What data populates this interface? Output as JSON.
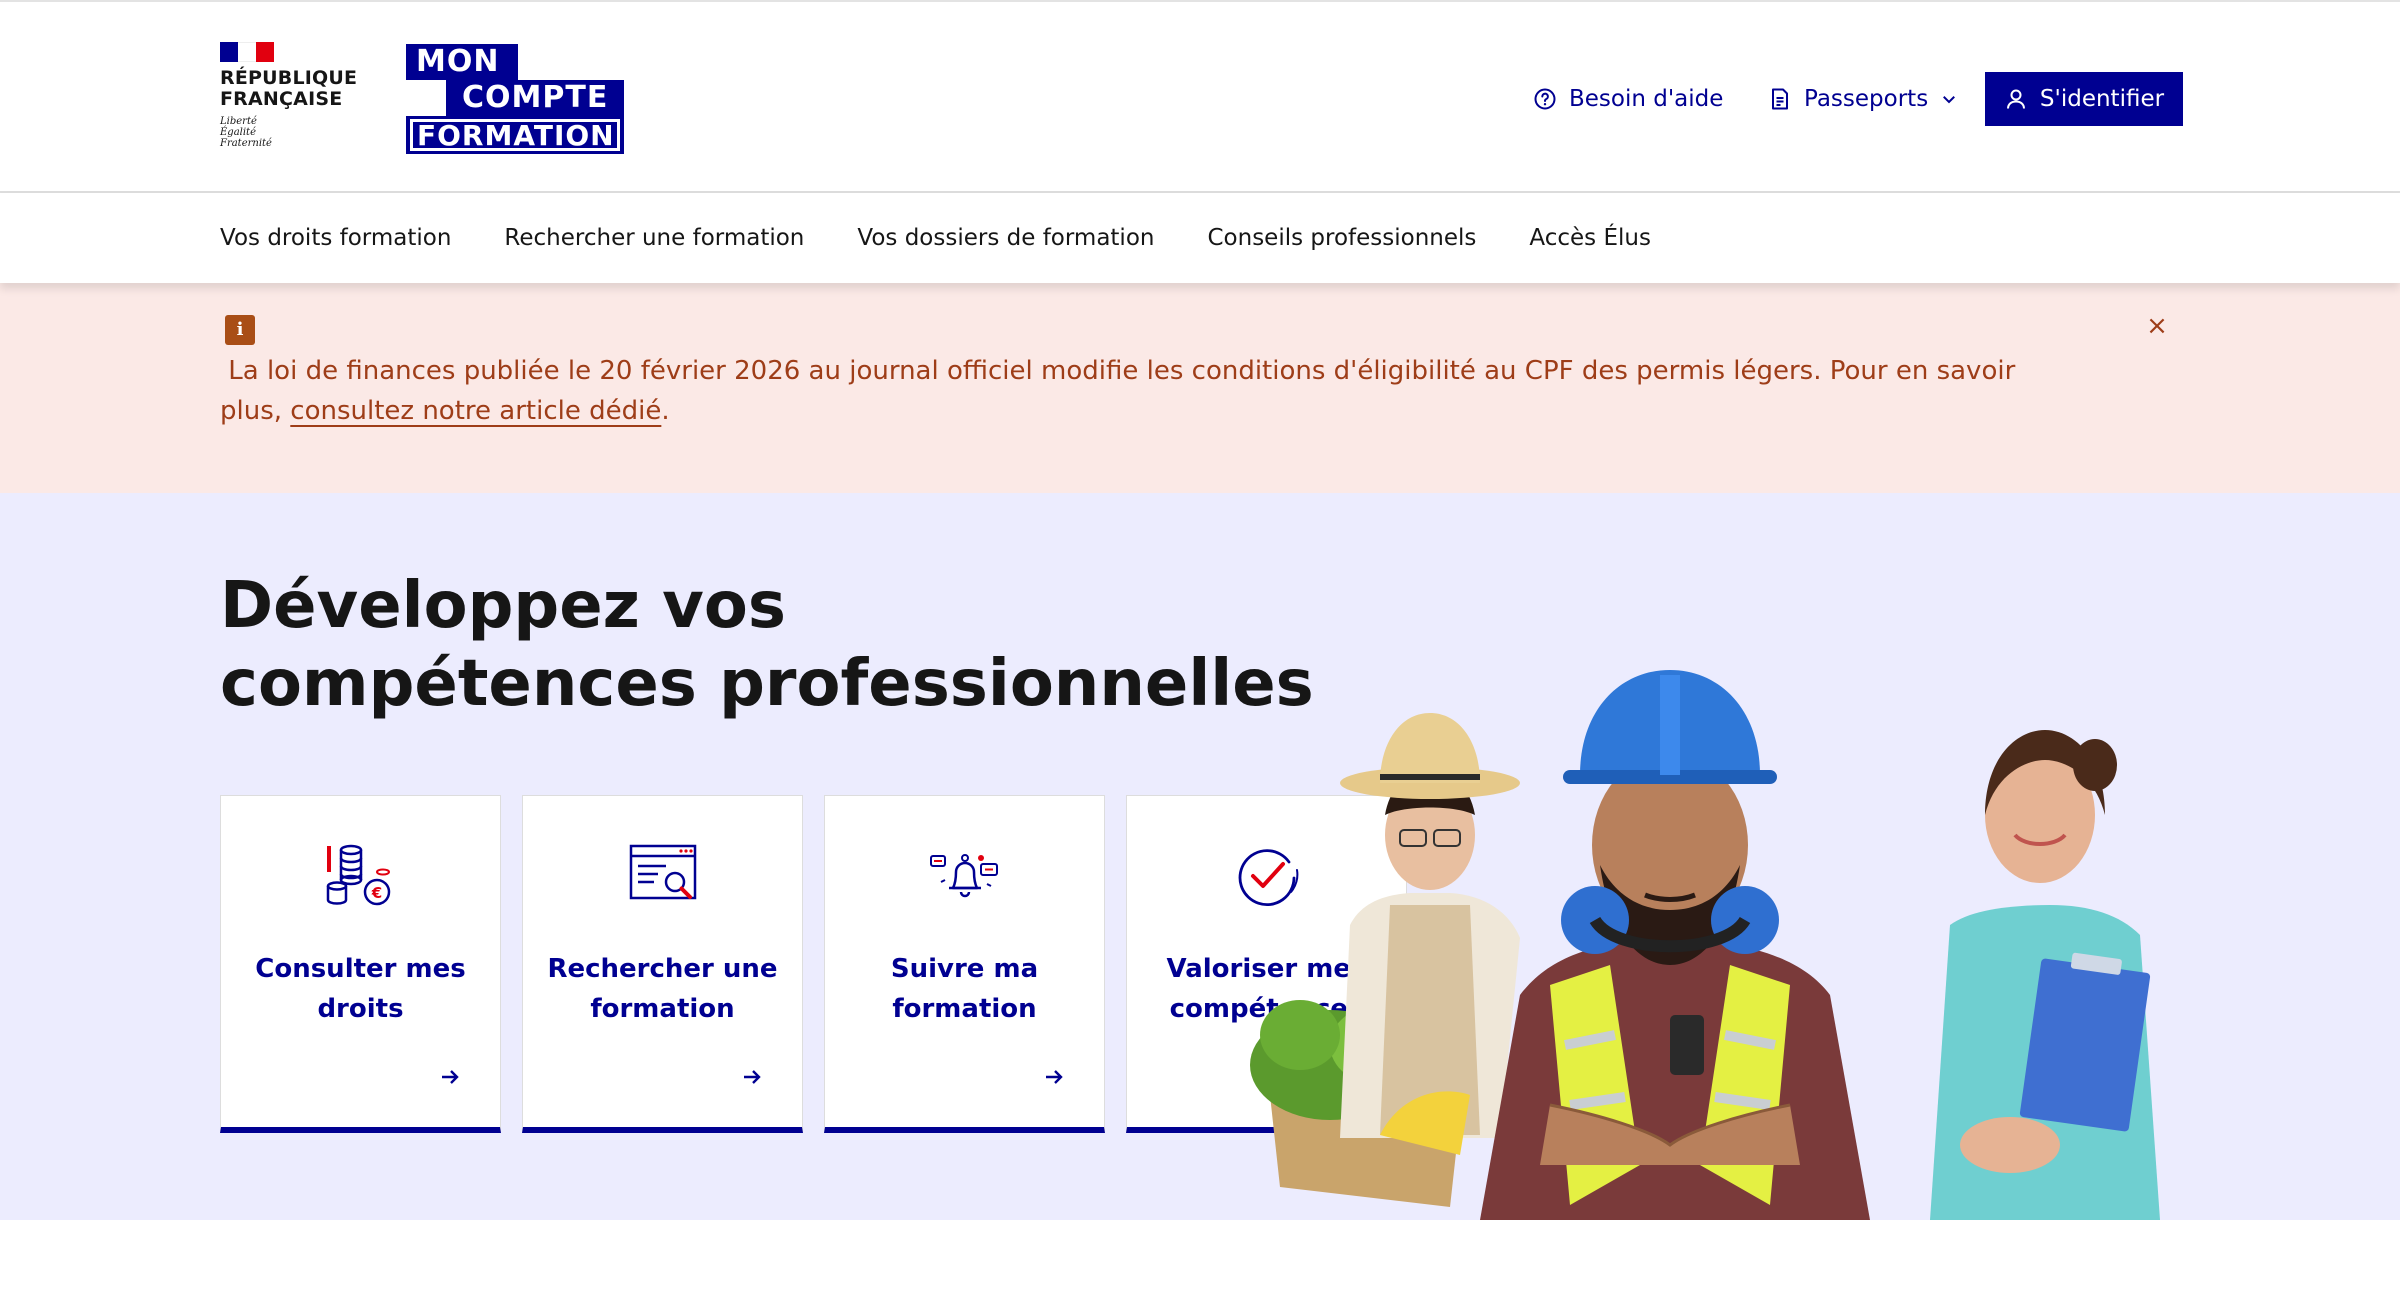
{
  "header": {
    "republique": {
      "line1": "RÉPUBLIQUE",
      "line2": "FRANÇAISE",
      "motto1": "Liberté",
      "motto2": "Égalité",
      "motto3": "Fraternité"
    },
    "mcf_logo": {
      "line1": "MON",
      "line2": "COMPTE",
      "line3": "FORMATION"
    },
    "tools": {
      "help_label": "Besoin d'aide",
      "passports_label": "Passeports",
      "login_label": "S'identifier"
    }
  },
  "nav": {
    "items": [
      {
        "label": "Vos droits formation"
      },
      {
        "label": "Rechercher une formation"
      },
      {
        "label": "Vos dossiers de formation"
      },
      {
        "label": "Conseils professionnels"
      },
      {
        "label": "Accès Élus"
      }
    ]
  },
  "notice": {
    "icon_letter": "i",
    "text": "La loi de finances publiée le 20 février 2026 au journal officiel modifie les conditions d'éligibilité au CPF des permis légers. Pour en savoir plus,",
    "link": "consultez notre article dédié",
    "text_after": ".",
    "close_glyph": "×"
  },
  "hero": {
    "title_line1": "Développez vos",
    "title_line2": "compétences professionnelles",
    "cards": [
      {
        "line1": "Consulter mes",
        "line2": "droits",
        "icon": "coins-euro-icon",
        "arrow": "arrow-right-icon"
      },
      {
        "line1": "Rechercher une",
        "line2": "formation",
        "icon": "search-browser-icon",
        "arrow": "arrow-right-icon"
      },
      {
        "line1": "Suivre ma",
        "line2": "formation",
        "icon": "bell-notification-icon",
        "arrow": "arrow-right-icon"
      },
      {
        "line1": "Valoriser mes",
        "line2": "compétences",
        "icon": "check-circle-icon",
        "arrow": "external-link-icon"
      }
    ]
  },
  "colors": {
    "brand_blue": "#000091",
    "marianne_red": "#e1000f",
    "notice_bg": "#fbe9e6",
    "notice_text": "#9e3d18",
    "hero_bg": "#ececfe"
  }
}
